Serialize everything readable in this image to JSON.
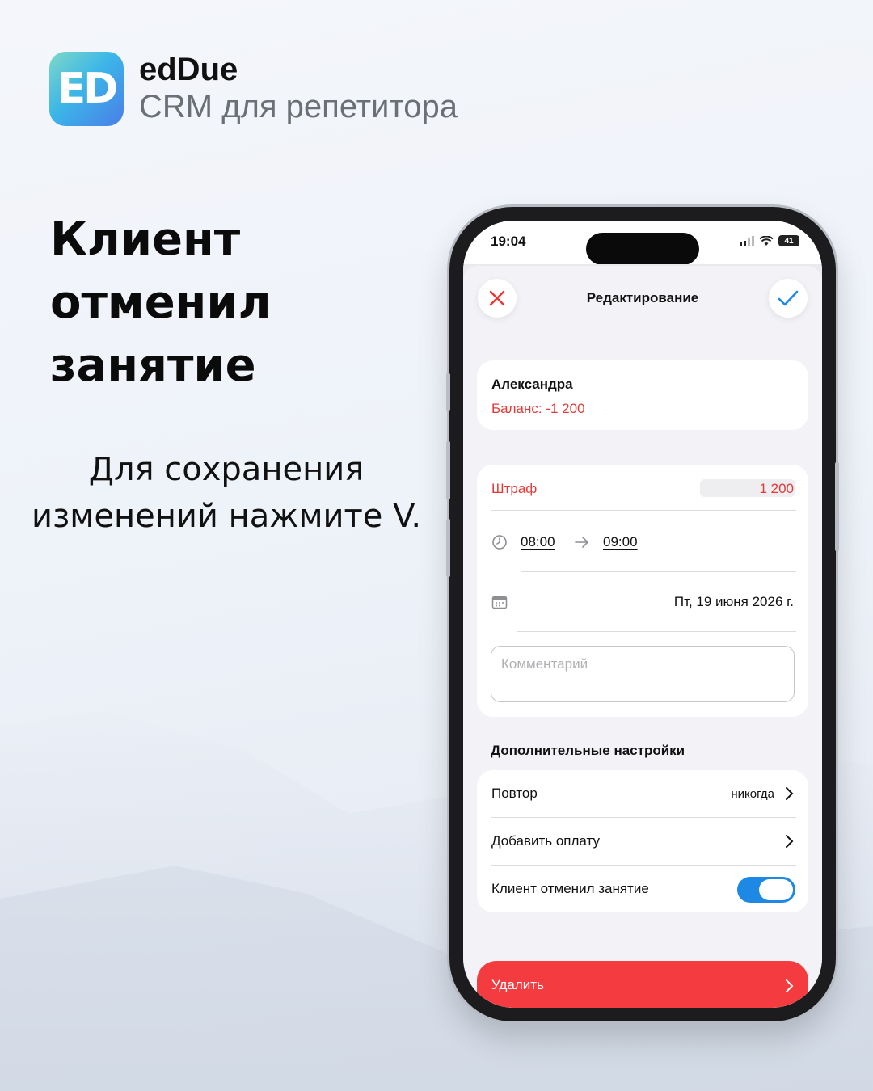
{
  "brand": {
    "logo_text": "ED",
    "name": "edDue",
    "subtitle": "CRM для репетитора"
  },
  "headline": "Клиент отменил занятие",
  "hint": "Для сохранения изменений нажмите V.",
  "phone": {
    "status_time": "19:04",
    "battery": "41",
    "nav": {
      "title": "Редактирование",
      "close_icon": "close-icon",
      "confirm_icon": "checkmark-icon",
      "close_color": "#e53935",
      "confirm_color": "#1e88e5"
    },
    "client": {
      "name": "Александра",
      "balance": "Баланс: -1 200"
    },
    "lesson": {
      "fine_label": "Штраф",
      "fine_value": "1 200",
      "time_start": "08:00",
      "time_end": "09:00",
      "date": "Пт, 19 июня 2026 г.",
      "comment_placeholder": "Комментарий"
    },
    "additional": {
      "heading": "Дополнительные настройки",
      "repeat_label": "Повтор",
      "repeat_value": "никогда",
      "add_payment_label": "Добавить оплату",
      "cancelled_label": "Клиент отменил занятие",
      "cancelled_on": true
    },
    "delete_label": "Удалить"
  },
  "colors": {
    "accent_red": "#f43c40",
    "toggle_blue": "#1e88e5"
  }
}
